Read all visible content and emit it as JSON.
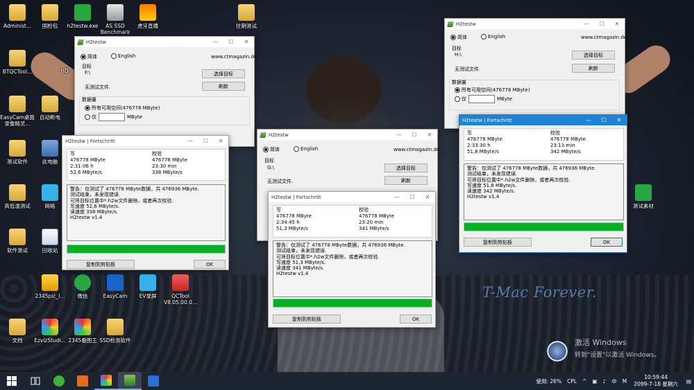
{
  "desktop": {
    "watermark": "T-Mac Forever.",
    "activation_line1": "激活 Windows",
    "activation_line2": "转到\"设置\"以激活 Windows。",
    "icons": [
      {
        "label": "Administ..."
      },
      {
        "label": "国检包"
      },
      {
        "label": "h2testw.exe"
      },
      {
        "label": "AS SSD Benchmark"
      },
      {
        "label": "虎牙直播"
      },
      {
        "label": "往期测试"
      },
      {
        "label": "BTQCTool..."
      },
      {
        "label": "HD"
      },
      {
        "label": "EasyCam桌面录像精灵..."
      },
      {
        "label": "自动断电"
      },
      {
        "label": "测试软件"
      },
      {
        "label": "此电脑"
      },
      {
        "label": "高低温测试"
      },
      {
        "label": "网络"
      },
      {
        "label": "软件测试"
      },
      {
        "label": "回收站"
      },
      {
        "label": "2345pic_l..."
      },
      {
        "label": "微信"
      },
      {
        "label": "EasyCam"
      },
      {
        "label": "EV录屏"
      },
      {
        "label": "QCTool V8.05.00.0..."
      },
      {
        "label": "文档"
      },
      {
        "label": "EzvizStudi..."
      },
      {
        "label": "2345看图王"
      },
      {
        "label": "SSD检测软件"
      },
      {
        "label": "测试素材"
      }
    ]
  },
  "h2testw": {
    "title": "H2testw",
    "lang_cn": "简体",
    "lang_en": "English",
    "site": "www.ctmagazin.de",
    "target_label": "目标",
    "select_target": "选择目标",
    "refresh": "刷新",
    "no_test_files": "无测试文件.",
    "data_volume": "数据量",
    "all_space": "所有可用空间(476778 MByte)",
    "only": "仅",
    "mbyte": "MByte",
    "windows": [
      {
        "drive": "F:\\"
      },
      {
        "drive": "G:\\"
      },
      {
        "drive": "H:\\"
      }
    ]
  },
  "progress": {
    "title": "H2testw | Fortschritt",
    "write_label": "写",
    "verify_label": "校验",
    "copy_button": "复制到剪贴板",
    "ok_button": "OK",
    "windows": [
      {
        "write_size": "476778 MByte",
        "write_time": "2:31:06 h",
        "write_speed": "52,6 MByte/s",
        "verify_size": "476778 MByte",
        "verify_time": "23:30 min",
        "verify_speed": "338 MByte/s",
        "log": "警告：仅测试了 476778 MByte数据，共 476936 MByte.\n测试结束，未发现错误.\n可将目标位置中*.h2w文件删除，或者再次校验.\n写速度 52,6 MByte/s.\n读速度 338 MByte/s.\nH2testw v1.4",
        "progress": 1.0
      },
      {
        "write_size": "476778 MByte",
        "write_time": "2:34:45 h",
        "write_speed": "51,3 MByte/s",
        "verify_size": "476778 MByte",
        "verify_time": "23:20 min",
        "verify_speed": "341 MByte/s",
        "log": "警告：仅测试了 476778 MByte数据，共 476936 MByte.\n测试结束，未发现错误.\n可将目标位置中*.h2w文件删除，或者再次校验.\n写速度 51,3 MByte/s.\n读速度 341 MByte/s.\nH2testw v1.4",
        "progress": 1.0
      },
      {
        "write_size": "476778 MByte",
        "write_time": "2:33:30 h",
        "write_speed": "51,8 MByte/s",
        "verify_size": "476778 MByte",
        "verify_time": "23:13 min",
        "verify_speed": "342 MByte/s",
        "log": "警告：仅测试了 476778 MByte数据，共 476936 MByte.\n测试结束，未发现错误.\n可将目标位置中*.h2w文件删除，或者再次校验.\n写速度 51,8 MByte/s.\n读速度 342 MByte/s.\nH2testw v1.4",
        "progress": 1.0
      }
    ]
  },
  "taskbar": {
    "usage": "使用: 26%",
    "cpl": "CPL",
    "ime_lang": "中",
    "ime_m": "M",
    "time": "10:59:44",
    "date": "2099-7-18 星期六"
  },
  "colors": {
    "progress_fill": "#06b025",
    "active_title": "#1e83d6",
    "taskbar": "#1d2432"
  }
}
